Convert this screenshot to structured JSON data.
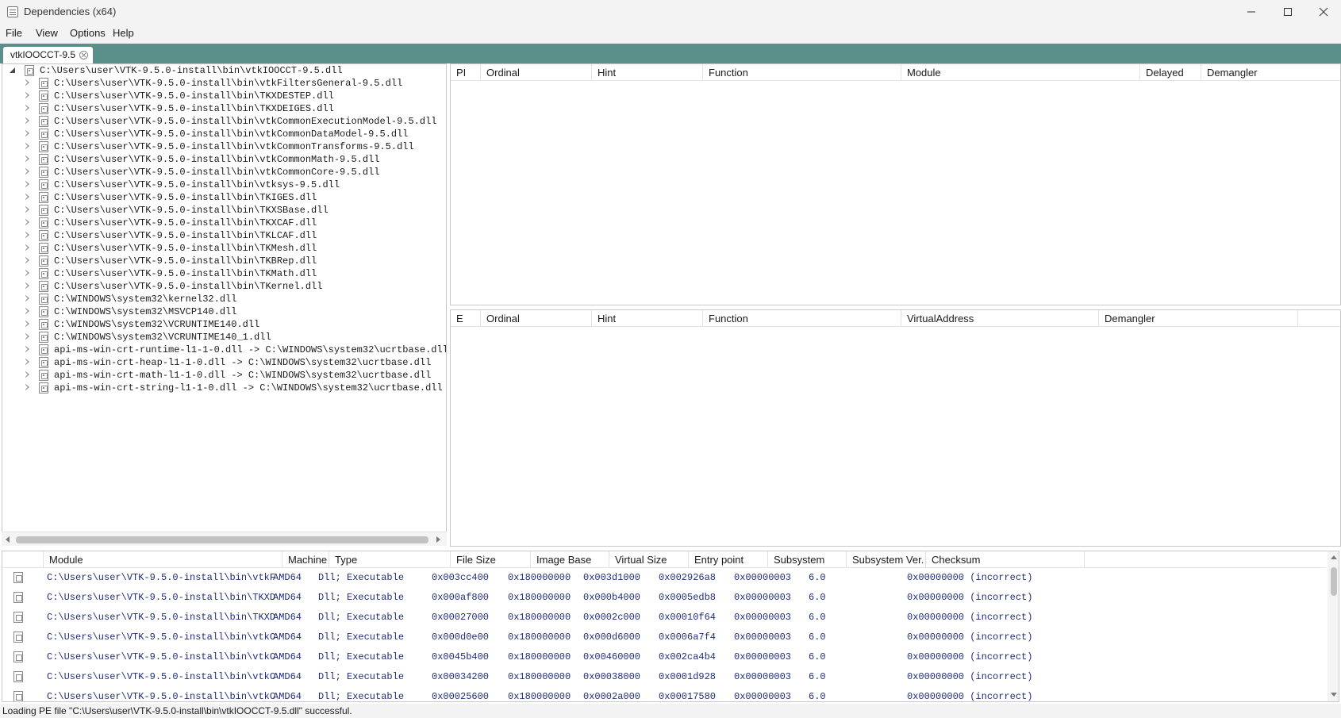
{
  "window": {
    "title": "Dependencies (x64)",
    "controls": [
      "minimize-icon",
      "maximize-icon",
      "close-icon"
    ]
  },
  "menu": {
    "items": [
      "File",
      "View",
      "Options",
      "Help"
    ]
  },
  "tabs": [
    {
      "label": "vtkIOOCCT-9.5"
    }
  ],
  "tree": {
    "root": "C:\\Users\\user\\VTK-9.5.0-install\\bin\\vtkIOOCCT-9.5.dll",
    "children": [
      "C:\\Users\\user\\VTK-9.5.0-install\\bin\\vtkFiltersGeneral-9.5.dll",
      "C:\\Users\\user\\VTK-9.5.0-install\\bin\\TKXDESTEP.dll",
      "C:\\Users\\user\\VTK-9.5.0-install\\bin\\TKXDEIGES.dll",
      "C:\\Users\\user\\VTK-9.5.0-install\\bin\\vtkCommonExecutionModel-9.5.dll",
      "C:\\Users\\user\\VTK-9.5.0-install\\bin\\vtkCommonDataModel-9.5.dll",
      "C:\\Users\\user\\VTK-9.5.0-install\\bin\\vtkCommonTransforms-9.5.dll",
      "C:\\Users\\user\\VTK-9.5.0-install\\bin\\vtkCommonMath-9.5.dll",
      "C:\\Users\\user\\VTK-9.5.0-install\\bin\\vtkCommonCore-9.5.dll",
      "C:\\Users\\user\\VTK-9.5.0-install\\bin\\vtksys-9.5.dll",
      "C:\\Users\\user\\VTK-9.5.0-install\\bin\\TKIGES.dll",
      "C:\\Users\\user\\VTK-9.5.0-install\\bin\\TKXSBase.dll",
      "C:\\Users\\user\\VTK-9.5.0-install\\bin\\TKXCAF.dll",
      "C:\\Users\\user\\VTK-9.5.0-install\\bin\\TKLCAF.dll",
      "C:\\Users\\user\\VTK-9.5.0-install\\bin\\TKMesh.dll",
      "C:\\Users\\user\\VTK-9.5.0-install\\bin\\TKBRep.dll",
      "C:\\Users\\user\\VTK-9.5.0-install\\bin\\TKMath.dll",
      "C:\\Users\\user\\VTK-9.5.0-install\\bin\\TKernel.dll",
      "C:\\WINDOWS\\system32\\kernel32.dll",
      "C:\\WINDOWS\\system32\\MSVCP140.dll",
      "C:\\WINDOWS\\system32\\VCRUNTIME140.dll",
      "C:\\WINDOWS\\system32\\VCRUNTIME140_1.dll",
      "api-ms-win-crt-runtime-l1-1-0.dll -> C:\\WINDOWS\\system32\\ucrtbase.dll",
      "api-ms-win-crt-heap-l1-1-0.dll -> C:\\WINDOWS\\system32\\ucrtbase.dll",
      "api-ms-win-crt-math-l1-1-0.dll -> C:\\WINDOWS\\system32\\ucrtbase.dll",
      "api-ms-win-crt-string-l1-1-0.dll -> C:\\WINDOWS\\system32\\ucrtbase.dll"
    ]
  },
  "imports": {
    "columns": [
      "PI",
      "Ordinal",
      "Hint",
      "Function",
      "Module",
      "Delayed",
      "Demangler"
    ]
  },
  "exports": {
    "columns": [
      "E",
      "Ordinal",
      "Hint",
      "Function",
      "VirtualAddress",
      "Demangler"
    ]
  },
  "modules": {
    "columns": [
      "Module",
      "Machine",
      "Type",
      "File Size",
      "Image Base",
      "Virtual Size",
      "Entry point",
      "Subsystem",
      "Subsystem Ver.",
      "Checksum"
    ],
    "rows": [
      [
        "C:\\Users\\user\\VTK-9.5.0-install\\bin\\vtkF",
        "AMD64",
        "Dll; Executable",
        "0x003cc400",
        "0x180000000",
        "0x003d1000",
        "0x002926a8",
        "0x00000003",
        "6.0",
        "0x00000000 (incorrect)"
      ],
      [
        "C:\\Users\\user\\VTK-9.5.0-install\\bin\\TKXD",
        "AMD64",
        "Dll; Executable",
        "0x000af800",
        "0x180000000",
        "0x000b4000",
        "0x0005edb8",
        "0x00000003",
        "6.0",
        "0x00000000 (incorrect)"
      ],
      [
        "C:\\Users\\user\\VTK-9.5.0-install\\bin\\TKXD",
        "AMD64",
        "Dll; Executable",
        "0x00027000",
        "0x180000000",
        "0x0002c000",
        "0x00010f64",
        "0x00000003",
        "6.0",
        "0x00000000 (incorrect)"
      ],
      [
        "C:\\Users\\user\\VTK-9.5.0-install\\bin\\vtkC",
        "AMD64",
        "Dll; Executable",
        "0x000d0e00",
        "0x180000000",
        "0x000d6000",
        "0x0006a7f4",
        "0x00000003",
        "6.0",
        "0x00000000 (incorrect)"
      ],
      [
        "C:\\Users\\user\\VTK-9.5.0-install\\bin\\vtkC",
        "AMD64",
        "Dll; Executable",
        "0x0045b400",
        "0x180000000",
        "0x00460000",
        "0x002ca4b4",
        "0x00000003",
        "6.0",
        "0x00000000 (incorrect)"
      ],
      [
        "C:\\Users\\user\\VTK-9.5.0-install\\bin\\vtkC",
        "AMD64",
        "Dll; Executable",
        "0x00034200",
        "0x180000000",
        "0x00038000",
        "0x0001d928",
        "0x00000003",
        "6.0",
        "0x00000000 (incorrect)"
      ],
      [
        "C:\\Users\\user\\VTK-9.5.0-install\\bin\\vtkC",
        "AMD64",
        "Dll; Executable",
        "0x00025600",
        "0x180000000",
        "0x0002a000",
        "0x00017580",
        "0x00000003",
        "6.0",
        "0x00000000 (incorrect)"
      ]
    ]
  },
  "status": {
    "text": "Loading PE file \"C:\\Users\\user\\VTK-9.5.0-install\\bin\\vtkIOOCCT-9.5.dll\" successful."
  },
  "colors": {
    "tab_strip": "#5a9089",
    "module_text": "#1f2d7a"
  }
}
